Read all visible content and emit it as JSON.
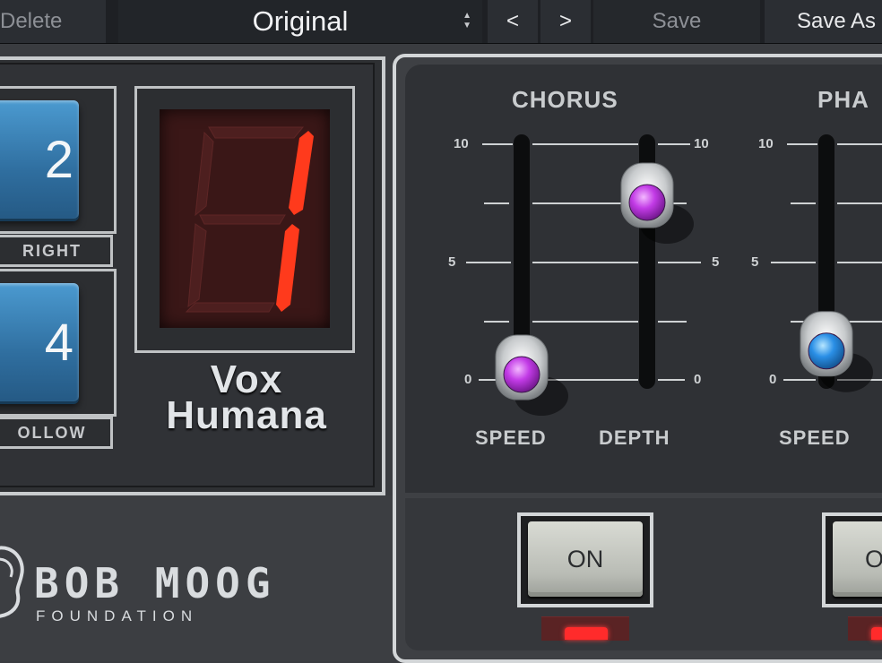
{
  "toolbar": {
    "delete_label": "Delete",
    "preset_name": "Original",
    "prev_label": "<",
    "next_label": ">",
    "save_label": "Save",
    "save_as_label": "Save As"
  },
  "left_panel": {
    "button_top": {
      "value": "2",
      "label": "RIGHT"
    },
    "button_bottom": {
      "value": "4",
      "label": "OLLOW"
    },
    "display_digit": "1",
    "voice_name_line1": "Vox",
    "voice_name_line2": "Humana"
  },
  "chorus": {
    "title": "CHORUS",
    "scale_top": "10",
    "scale_mid": "5",
    "scale_bottom": "0",
    "speed_label": "SPEED",
    "depth_label": "DEPTH",
    "speed_value": 0,
    "depth_value": 7.3,
    "knob_color": "#c23be6",
    "on_label": "ON"
  },
  "phaser": {
    "title": "PHA",
    "scale_top": "10",
    "scale_mid": "5",
    "scale_bottom": "0",
    "speed_label": "SPEED",
    "speed_value": 1.0,
    "knob_color": "#2a8fe6",
    "on_label": "O"
  },
  "logo": {
    "name": "BOB MOOG",
    "subtitle": "FOUNDATION"
  },
  "colors": {
    "led_on": "#ff2b2b",
    "segment_on": "#ff3a1c",
    "button_blue": "#3a85bd"
  }
}
